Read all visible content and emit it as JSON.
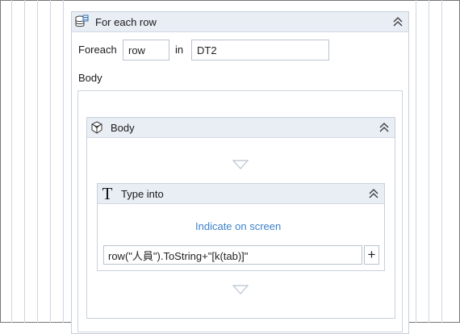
{
  "foreach_activity": {
    "title": "For each row",
    "icon": "datatable-rows-icon",
    "foreach_label": "Foreach",
    "item_variable": "row",
    "in_label": "in",
    "collection": "DT2",
    "body_label": "Body"
  },
  "body_sequence": {
    "title": "Body",
    "icon": "sequence-body-icon"
  },
  "type_into": {
    "title": "Type into",
    "icon": "type-into-T-icon",
    "indicate_label": "Indicate on screen",
    "text_value": "row(\"人員\").ToString+\"[k(tab)]\"",
    "add_button_label": "+"
  },
  "colors": {
    "header_bg": "#e9eef5",
    "border": "#c8d0db",
    "link": "#3c82cc",
    "drop_arrow": "#b8c2ce"
  }
}
